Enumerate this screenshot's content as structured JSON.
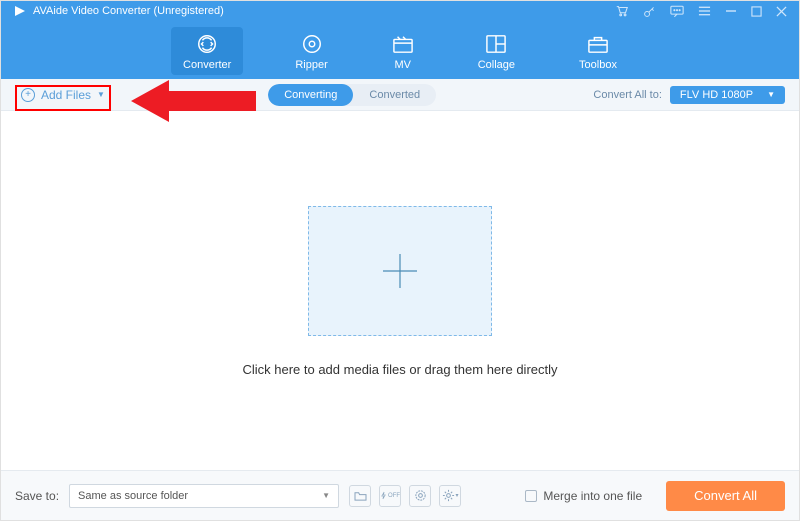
{
  "app": {
    "title": "AVAide Video Converter (Unregistered)"
  },
  "nav": {
    "items": [
      {
        "label": "Converter"
      },
      {
        "label": "Ripper"
      },
      {
        "label": "MV"
      },
      {
        "label": "Collage"
      },
      {
        "label": "Toolbox"
      }
    ]
  },
  "subbar": {
    "add_files": "Add Files",
    "tabs": {
      "converting": "Converting",
      "converted": "Converted"
    },
    "convert_all_label": "Convert All to:",
    "format": "FLV HD 1080P"
  },
  "main": {
    "drop_text": "Click here to add media files or drag them here directly"
  },
  "bottom": {
    "save_to_label": "Save to:",
    "save_to_value": "Same as source folder",
    "merge_label": "Merge into one file",
    "convert_btn": "Convert All"
  }
}
